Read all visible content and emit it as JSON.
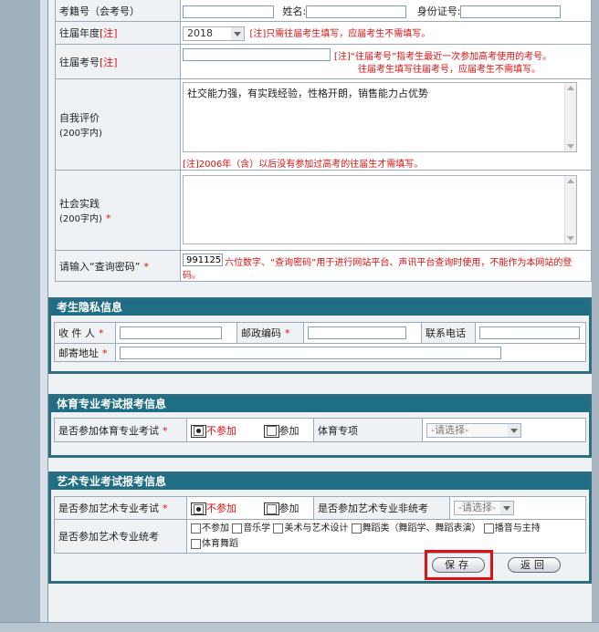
{
  "form": {
    "exam_no_label": "考籍号（会考号）",
    "name_label": "姓名:",
    "id_label": "身份证号:",
    "year_label": "往届年度",
    "note_tag": "[注]",
    "year_value": "2018",
    "year_note": "[注]只需往届考生填写，应届考生不需填写。",
    "prev_no_label": "往届考号",
    "prev_no_note_1": "[注]“往届考号”指考生最近一次参加高考使用的考号。",
    "prev_no_note_2": "往届考生填写往届考号，应届考生不需填写。",
    "self_eval_label": "自我评价",
    "self_eval_sub": "(200字内)",
    "self_eval_text": "社交能力强，有实践经验，性格开朗，销售能力占优势",
    "self_eval_note": "[注]2006年（含）以后没有参加过高考的往届生才需填写。",
    "social_label": "社会实践",
    "social_sub": "(200字内)",
    "query_pwd_label": "请输入“查询密码”",
    "query_pwd_value": "991125",
    "query_pwd_note": "六位数字、“查询密码”用于进行网站平台、声讯平台查询时使用，不能作为本网站的登",
    "query_pwd_note2": "码。",
    "star": "*"
  },
  "privacy": {
    "title": "考生隐私信息",
    "recipient_label": "收 件 人",
    "postcode_label": "邮政编码",
    "phone_label": "联系电话",
    "address_label": "邮寄地址"
  },
  "sports": {
    "title": "体育专业考试报考信息",
    "join_label": "是否参加体育专业考试",
    "opt_no": "不参加",
    "opt_yes": "参加",
    "item_label": "体育专项",
    "item_select": "-请选择-"
  },
  "arts": {
    "title": "艺术专业考试报考信息",
    "join_label": "是否参加艺术专业考试",
    "opt_no": "不参加",
    "opt_yes": "参加",
    "nonunified_label": "是否参加艺术专业非统考",
    "nonunified_select": "-请选择-",
    "unified_label": "是否参加艺术专业统考",
    "categories": [
      "不参加",
      "音乐学",
      "美术与艺术设计",
      "舞蹈类（舞蹈学、舞蹈表演）",
      "播音与主持",
      "体育舞蹈"
    ]
  },
  "buttons": {
    "save": "保存",
    "back": "返回"
  }
}
